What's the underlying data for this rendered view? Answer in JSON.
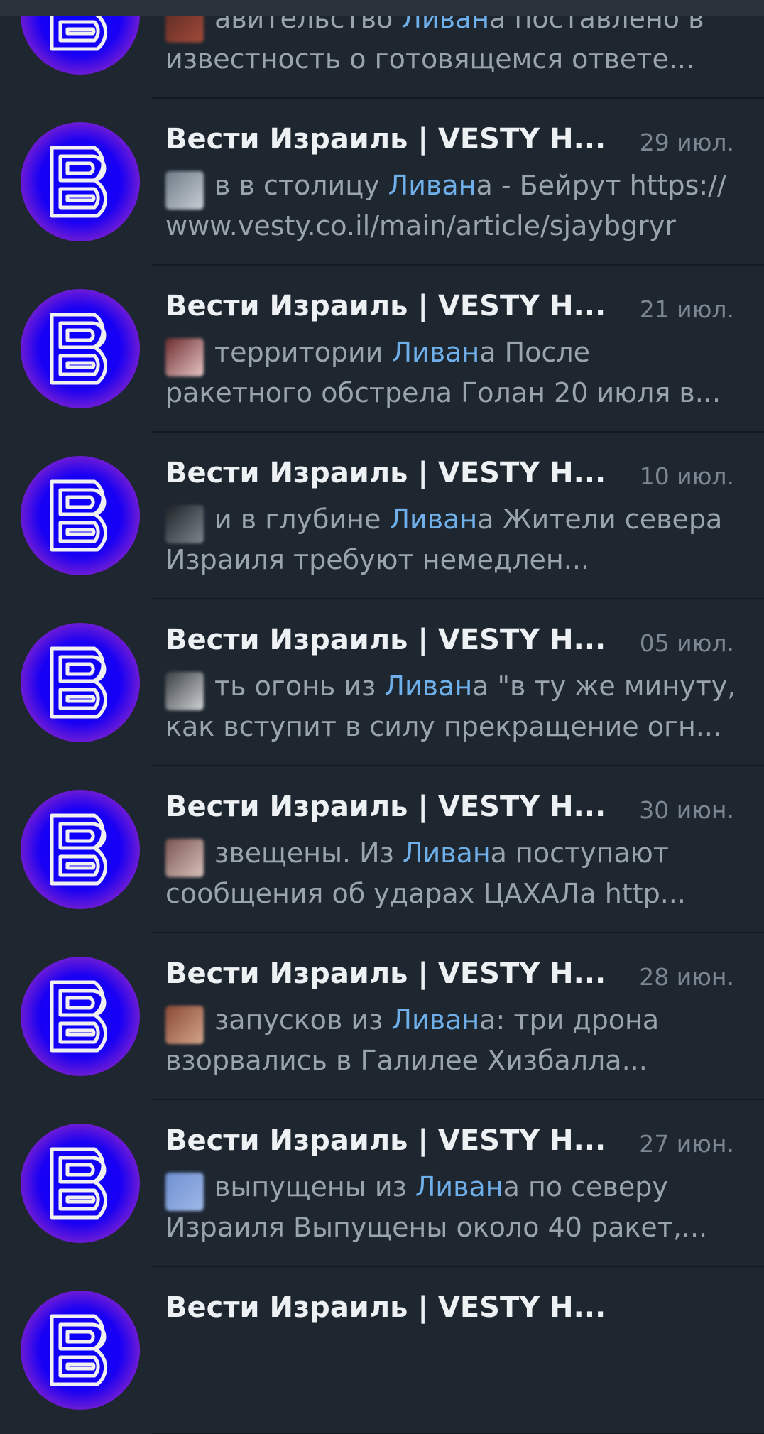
{
  "chats": [
    {
      "title": "",
      "date": "",
      "pre": "авительство ",
      "highlight": "Ливан",
      "post": "а поставлено в",
      "line2": "известность о готовящемся ответе...",
      "thumb_colors": [
        "#5a2a22",
        "#a24b3a"
      ]
    },
    {
      "title": "Вести Израиль | VESTY Н...",
      "date": "29 июл.",
      "pre": "в в столицу ",
      "highlight": "Ливан",
      "post": "а - Бейрут  https://",
      "line2": "www.vesty.co.il/main/article/sjaybgryr",
      "thumb_colors": [
        "#6f7b86",
        "#c7ced5"
      ]
    },
    {
      "title": "Вести Израиль | VESTY Н...",
      "date": "21 июл.",
      "pre": " территории ",
      "highlight": "Ливан",
      "post": "а  После",
      "line2": "ракетного обстрела Голан 20 июля в...",
      "thumb_colors": [
        "#6c2d2f",
        "#e8c5c5"
      ]
    },
    {
      "title": "Вести Израиль | VESTY Н...",
      "date": "10 июл.",
      "pre": "и в глубине ",
      "highlight": "Ливан",
      "post": "а  Жители севера",
      "line2": "Израиля требуют немедлен...",
      "thumb_colors": [
        "#1c2226",
        "#7e878e"
      ]
    },
    {
      "title": "Вести Израиль | VESTY Н...",
      "date": "05 июл.",
      "pre": "ть огонь из ",
      "highlight": "Ливан",
      "post": "а \"в ту же минуту,",
      "line2": "как вступит в силу прекращение огн...",
      "thumb_colors": [
        "#3a3f44",
        "#d0d3d6"
      ]
    },
    {
      "title": "Вести Израиль | VESTY Н...",
      "date": "30 июн.",
      "pre": "звещены. Из ",
      "highlight": "Ливан",
      "post": "а поступают",
      "line2": "сообщения об ударах ЦАХАЛа  http...",
      "thumb_colors": [
        "#7a5550",
        "#d9c2bb"
      ]
    },
    {
      "title": "Вести Израиль | VESTY Н...",
      "date": "28 июн.",
      "pre": "запусков из ",
      "highlight": "Ливан",
      "post": "а: три дрона",
      "line2": "взорвались в Галилее  Хизбалла...",
      "thumb_colors": [
        "#8a4a36",
        "#d3a58a"
      ]
    },
    {
      "title": "Вести Израиль | VESTY Н...",
      "date": "27 июн.",
      "pre": "выпущены из ",
      "highlight": "Ливан",
      "post": "а по северу",
      "line2": "Израиля  Выпущены около 40 ракет,...",
      "thumb_colors": [
        "#6f8fd0",
        "#9fb9e8"
      ]
    },
    {
      "title": "Вести Израиль | VESTY Н...",
      "date": "",
      "pre": "",
      "highlight": "",
      "post": "",
      "line2": "",
      "thumb_colors": [
        "#1e2630",
        "#1e2630"
      ]
    }
  ]
}
